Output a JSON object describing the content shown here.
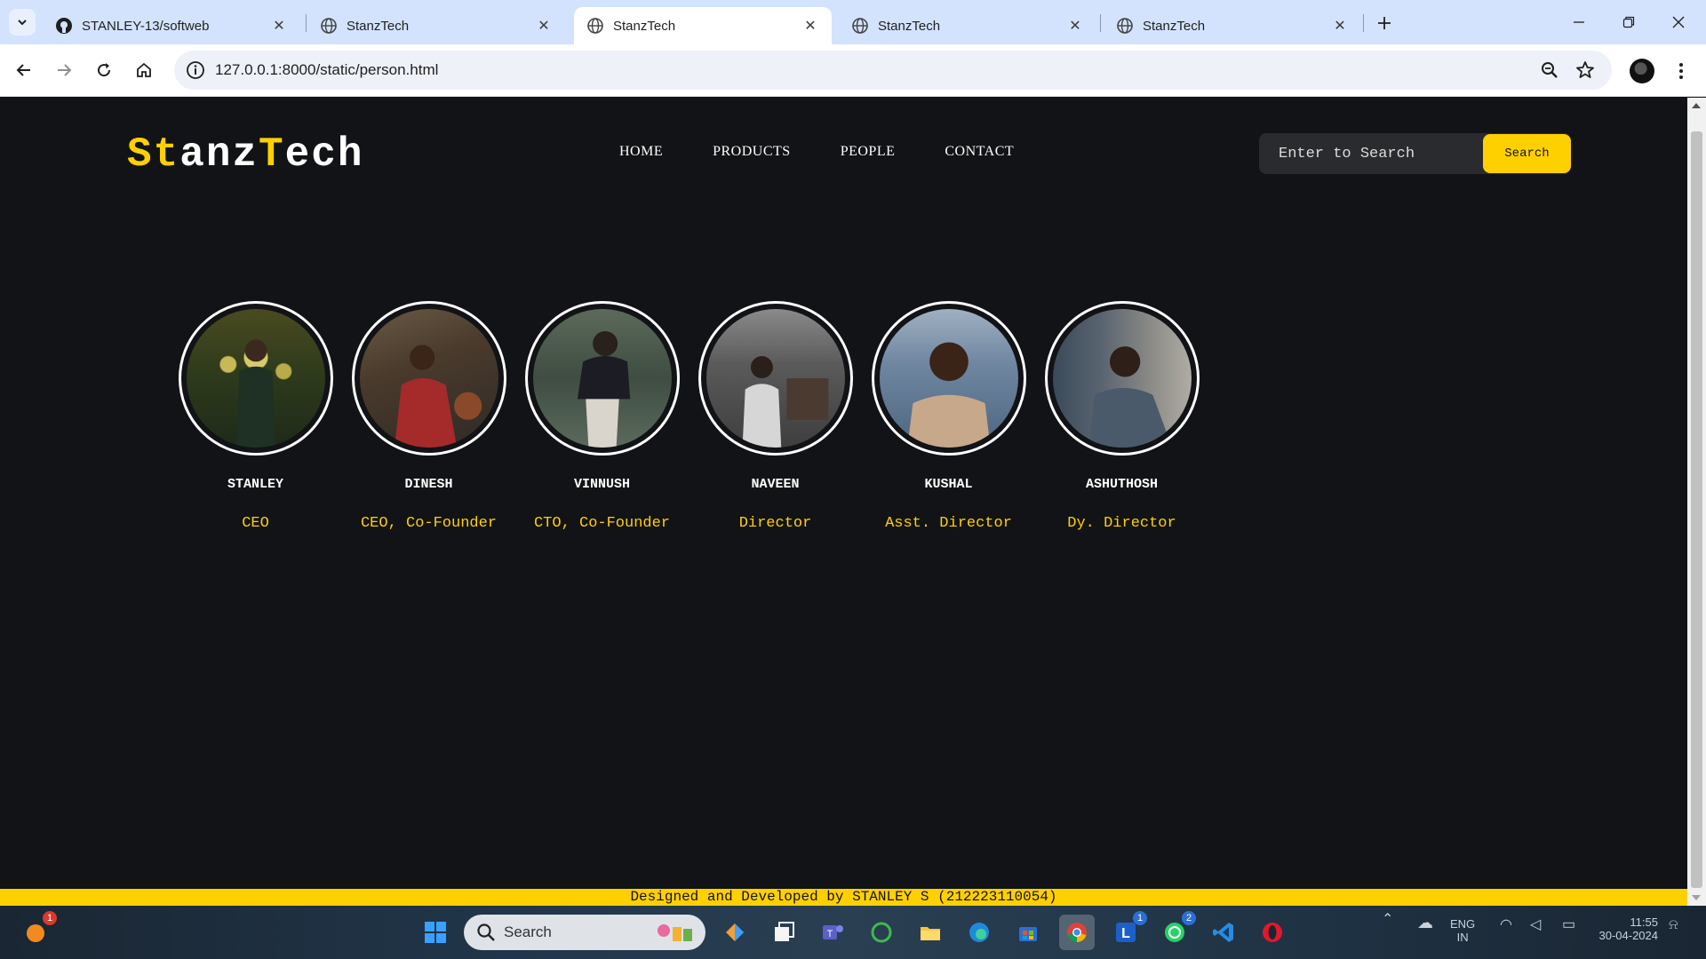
{
  "browser": {
    "tabs": [
      {
        "title": "STANLEY-13/softweb",
        "icon": "github-icon",
        "active": false
      },
      {
        "title": "StanzTech",
        "icon": "globe-icon",
        "active": false
      },
      {
        "title": "StanzTech",
        "icon": "globe-icon",
        "active": true
      },
      {
        "title": "StanzTech",
        "icon": "globe-icon",
        "active": false
      },
      {
        "title": "StanzTech",
        "icon": "globe-icon",
        "active": false
      }
    ],
    "url": "127.0.0.1:8000/static/person.html"
  },
  "site": {
    "brand": {
      "part1": "St",
      "part2": "anz",
      "part3": "T",
      "part4": "ech"
    },
    "nav": [
      "HOME",
      "PRODUCTS",
      "PEOPLE",
      "CONTACT"
    ],
    "search": {
      "placeholder": "Enter to Search",
      "button": "Search"
    },
    "people": [
      {
        "name": "STANLEY",
        "role": "CEO"
      },
      {
        "name": "DINESH",
        "role": "CEO, Co-Founder"
      },
      {
        "name": "VINNUSH",
        "role": "CTO, Co-Founder"
      },
      {
        "name": "NAVEEN",
        "role": "Director"
      },
      {
        "name": "KUSHAL",
        "role": "Asst. Director"
      },
      {
        "name": "ASHUTHOSH",
        "role": "Dy. Director"
      }
    ],
    "footer": "Designed and Developed by STANLEY S (212223110054)"
  },
  "taskbar": {
    "search_label": "Search",
    "badges": {
      "weather": "1",
      "l_app": "1",
      "whatsapp": "2"
    },
    "tray": {
      "lang1": "ENG",
      "lang2": "IN",
      "time": "11:55",
      "date": "30-04-2024"
    }
  },
  "colors": {
    "accent": "#ffd000",
    "page_bg": "#121316",
    "tabstrip": "#d3e3fd"
  }
}
